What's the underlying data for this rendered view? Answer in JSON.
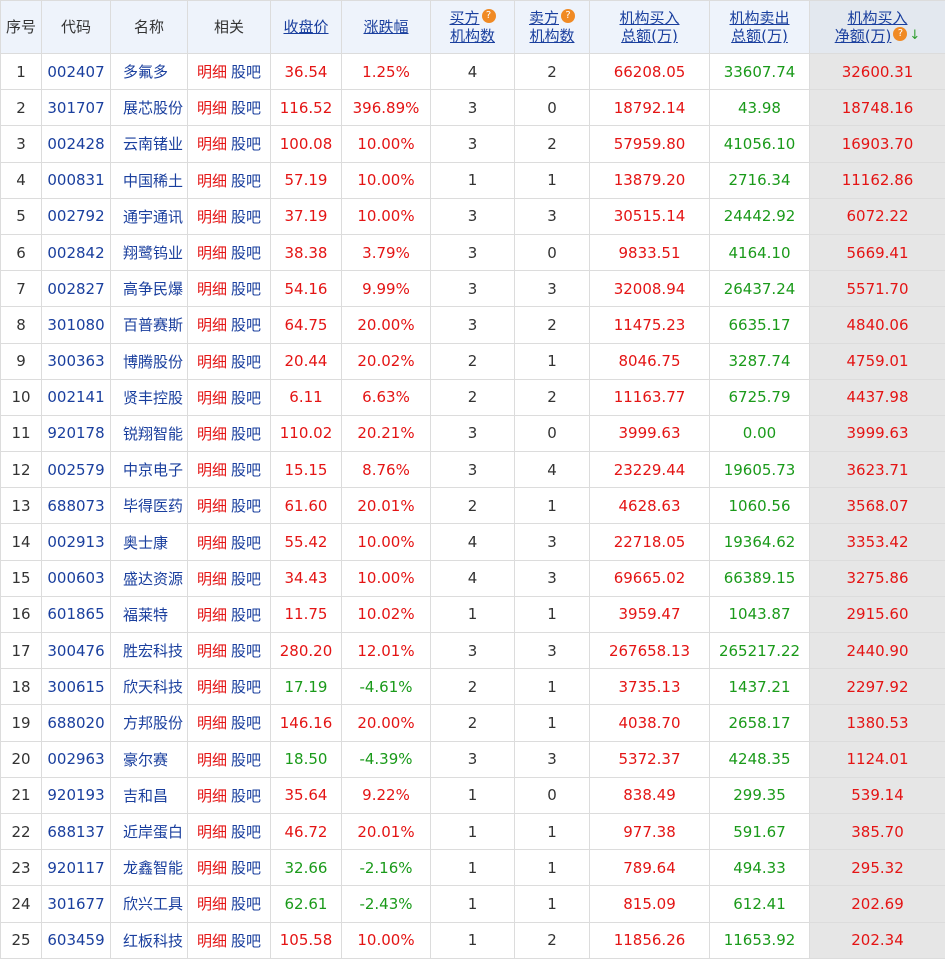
{
  "headers": {
    "seq": "序号",
    "code": "代码",
    "name": "名称",
    "related": "相关",
    "close": "收盘价",
    "change": "涨跌幅",
    "buy_count_l1": "买方",
    "buy_count_l2": "机构数",
    "sell_count_l1": "卖方",
    "sell_count_l2": "机构数",
    "buy_total_l1": "机构买入",
    "buy_total_l2": "总额(万)",
    "sell_total_l1": "机构卖出",
    "sell_total_l2": "总额(万)",
    "net_l1": "机构买入",
    "net_l2": "净额(万)",
    "help_glyph": "?",
    "sort_glyph": "↓"
  },
  "colors": {
    "up": "#e41414",
    "down": "#1a9a1a",
    "link": "#1a3f9e",
    "net_bg": "#e6e6e6"
  },
  "icons": {
    "help": "question-icon",
    "sort": "sort-desc-arrow-icon"
  },
  "links": {
    "detail": "明细",
    "forum": "股吧"
  },
  "rows": [
    {
      "seq": "1",
      "code": "002407",
      "name": "多氟多",
      "close": "36.54",
      "change": "1.25%",
      "buy_n": "4",
      "sell_n": "2",
      "buy_amt": "66208.05",
      "sell_amt": "33607.74",
      "net": "32600.31",
      "dir": "up"
    },
    {
      "seq": "2",
      "code": "301707",
      "name": "展芯股份",
      "close": "116.52",
      "change": "396.89%",
      "buy_n": "3",
      "sell_n": "0",
      "buy_amt": "18792.14",
      "sell_amt": "43.98",
      "net": "18748.16",
      "dir": "up"
    },
    {
      "seq": "3",
      "code": "002428",
      "name": "云南锗业",
      "close": "100.08",
      "change": "10.00%",
      "buy_n": "3",
      "sell_n": "2",
      "buy_amt": "57959.80",
      "sell_amt": "41056.10",
      "net": "16903.70",
      "dir": "up"
    },
    {
      "seq": "4",
      "code": "000831",
      "name": "中国稀土",
      "close": "57.19",
      "change": "10.00%",
      "buy_n": "1",
      "sell_n": "1",
      "buy_amt": "13879.20",
      "sell_amt": "2716.34",
      "net": "11162.86",
      "dir": "up"
    },
    {
      "seq": "5",
      "code": "002792",
      "name": "通宇通讯",
      "close": "37.19",
      "change": "10.00%",
      "buy_n": "3",
      "sell_n": "3",
      "buy_amt": "30515.14",
      "sell_amt": "24442.92",
      "net": "6072.22",
      "dir": "up"
    },
    {
      "seq": "6",
      "code": "002842",
      "name": "翔鹭钨业",
      "close": "38.38",
      "change": "3.79%",
      "buy_n": "3",
      "sell_n": "0",
      "buy_amt": "9833.51",
      "sell_amt": "4164.10",
      "net": "5669.41",
      "dir": "up"
    },
    {
      "seq": "7",
      "code": "002827",
      "name": "高争民爆",
      "close": "54.16",
      "change": "9.99%",
      "buy_n": "3",
      "sell_n": "3",
      "buy_amt": "32008.94",
      "sell_amt": "26437.24",
      "net": "5571.70",
      "dir": "up"
    },
    {
      "seq": "8",
      "code": "301080",
      "name": "百普赛斯",
      "close": "64.75",
      "change": "20.00%",
      "buy_n": "3",
      "sell_n": "2",
      "buy_amt": "11475.23",
      "sell_amt": "6635.17",
      "net": "4840.06",
      "dir": "up"
    },
    {
      "seq": "9",
      "code": "300363",
      "name": "博腾股份",
      "close": "20.44",
      "change": "20.02%",
      "buy_n": "2",
      "sell_n": "1",
      "buy_amt": "8046.75",
      "sell_amt": "3287.74",
      "net": "4759.01",
      "dir": "up"
    },
    {
      "seq": "10",
      "code": "002141",
      "name": "贤丰控股",
      "close": "6.11",
      "change": "6.63%",
      "buy_n": "2",
      "sell_n": "2",
      "buy_amt": "11163.77",
      "sell_amt": "6725.79",
      "net": "4437.98",
      "dir": "up"
    },
    {
      "seq": "11",
      "code": "920178",
      "name": "锐翔智能",
      "close": "110.02",
      "change": "20.21%",
      "buy_n": "3",
      "sell_n": "0",
      "buy_amt": "3999.63",
      "sell_amt": "0.00",
      "net": "3999.63",
      "dir": "up"
    },
    {
      "seq": "12",
      "code": "002579",
      "name": "中京电子",
      "close": "15.15",
      "change": "8.76%",
      "buy_n": "3",
      "sell_n": "4",
      "buy_amt": "23229.44",
      "sell_amt": "19605.73",
      "net": "3623.71",
      "dir": "up"
    },
    {
      "seq": "13",
      "code": "688073",
      "name": "毕得医药",
      "close": "61.60",
      "change": "20.01%",
      "buy_n": "2",
      "sell_n": "1",
      "buy_amt": "4628.63",
      "sell_amt": "1060.56",
      "net": "3568.07",
      "dir": "up"
    },
    {
      "seq": "14",
      "code": "002913",
      "name": "奥士康",
      "close": "55.42",
      "change": "10.00%",
      "buy_n": "4",
      "sell_n": "3",
      "buy_amt": "22718.05",
      "sell_amt": "19364.62",
      "net": "3353.42",
      "dir": "up"
    },
    {
      "seq": "15",
      "code": "000603",
      "name": "盛达资源",
      "close": "34.43",
      "change": "10.00%",
      "buy_n": "4",
      "sell_n": "3",
      "buy_amt": "69665.02",
      "sell_amt": "66389.15",
      "net": "3275.86",
      "dir": "up"
    },
    {
      "seq": "16",
      "code": "601865",
      "name": "福莱特",
      "close": "11.75",
      "change": "10.02%",
      "buy_n": "1",
      "sell_n": "1",
      "buy_amt": "3959.47",
      "sell_amt": "1043.87",
      "net": "2915.60",
      "dir": "up"
    },
    {
      "seq": "17",
      "code": "300476",
      "name": "胜宏科技",
      "close": "280.20",
      "change": "12.01%",
      "buy_n": "3",
      "sell_n": "3",
      "buy_amt": "267658.13",
      "sell_amt": "265217.22",
      "net": "2440.90",
      "dir": "up"
    },
    {
      "seq": "18",
      "code": "300615",
      "name": "欣天科技",
      "close": "17.19",
      "change": "-4.61%",
      "buy_n": "2",
      "sell_n": "1",
      "buy_amt": "3735.13",
      "sell_amt": "1437.21",
      "net": "2297.92",
      "dir": "down"
    },
    {
      "seq": "19",
      "code": "688020",
      "name": "方邦股份",
      "close": "146.16",
      "change": "20.00%",
      "buy_n": "2",
      "sell_n": "1",
      "buy_amt": "4038.70",
      "sell_amt": "2658.17",
      "net": "1380.53",
      "dir": "up"
    },
    {
      "seq": "20",
      "code": "002963",
      "name": "豪尔赛",
      "close": "18.50",
      "change": "-4.39%",
      "buy_n": "3",
      "sell_n": "3",
      "buy_amt": "5372.37",
      "sell_amt": "4248.35",
      "net": "1124.01",
      "dir": "down"
    },
    {
      "seq": "21",
      "code": "920193",
      "name": "吉和昌",
      "close": "35.64",
      "change": "9.22%",
      "buy_n": "1",
      "sell_n": "0",
      "buy_amt": "838.49",
      "sell_amt": "299.35",
      "net": "539.14",
      "dir": "up"
    },
    {
      "seq": "22",
      "code": "688137",
      "name": "近岸蛋白",
      "close": "46.72",
      "change": "20.01%",
      "buy_n": "1",
      "sell_n": "1",
      "buy_amt": "977.38",
      "sell_amt": "591.67",
      "net": "385.70",
      "dir": "up"
    },
    {
      "seq": "23",
      "code": "920117",
      "name": "龙鑫智能",
      "close": "32.66",
      "change": "-2.16%",
      "buy_n": "1",
      "sell_n": "1",
      "buy_amt": "789.64",
      "sell_amt": "494.33",
      "net": "295.32",
      "dir": "down"
    },
    {
      "seq": "24",
      "code": "301677",
      "name": "欣兴工具",
      "close": "62.61",
      "change": "-2.43%",
      "buy_n": "1",
      "sell_n": "1",
      "buy_amt": "815.09",
      "sell_amt": "612.41",
      "net": "202.69",
      "dir": "down"
    },
    {
      "seq": "25",
      "code": "603459",
      "name": "红板科技",
      "close": "105.58",
      "change": "10.00%",
      "buy_n": "1",
      "sell_n": "2",
      "buy_amt": "11856.26",
      "sell_amt": "11653.92",
      "net": "202.34",
      "dir": "up"
    }
  ]
}
